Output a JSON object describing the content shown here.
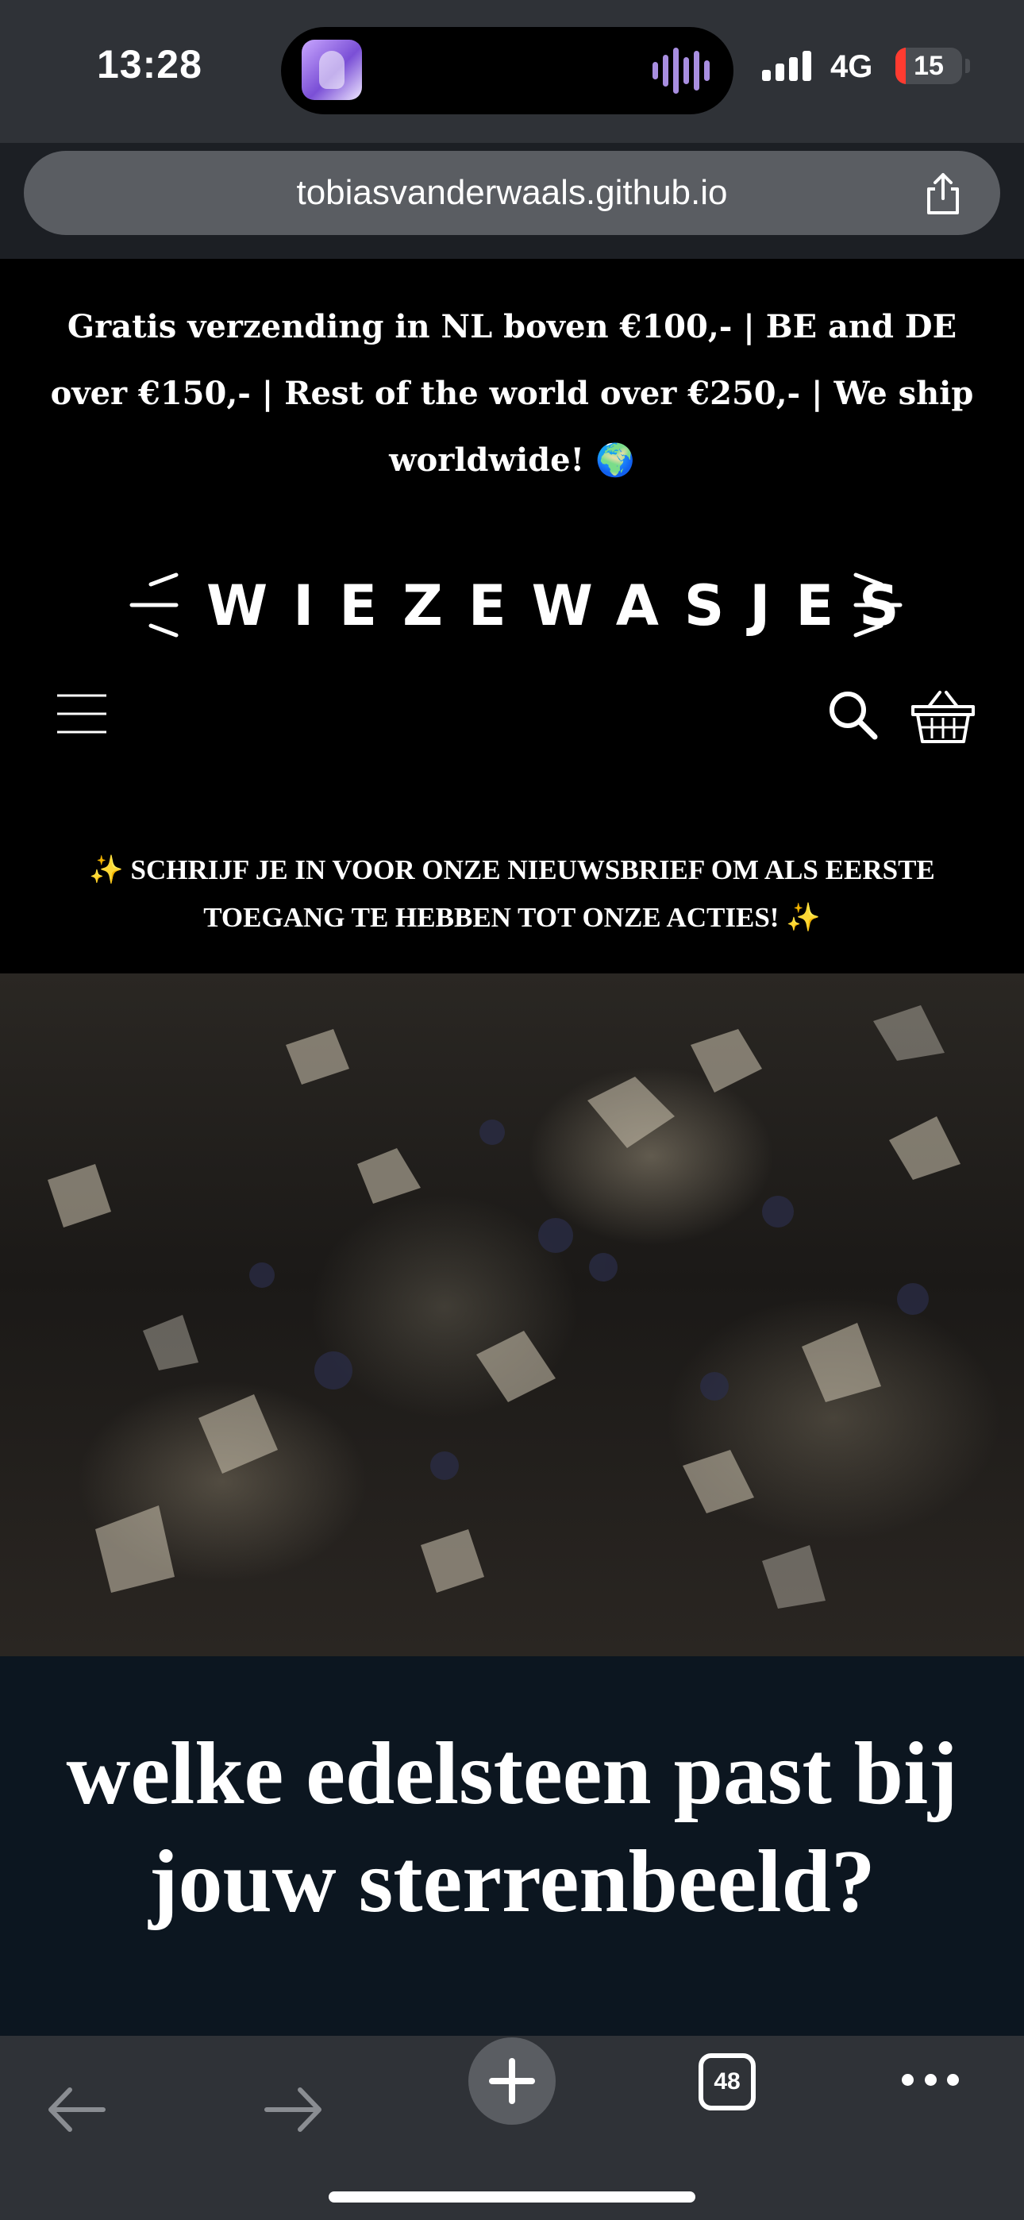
{
  "status_bar": {
    "time": "13:28",
    "network": "4G",
    "battery": "15",
    "battery_level": 0.15,
    "battery_color": "#ff3b30",
    "island_app_icon": "avatar-icon",
    "island_activity_icon": "waveform-icon"
  },
  "browser": {
    "url": "tobiasvanderwaals.github.io",
    "share_icon": "share-icon",
    "tab_count": "48",
    "toolbar_icons": [
      "back-arrow-icon",
      "forward-arrow-icon",
      "plus-icon",
      "tabs-icon",
      "more-icon"
    ]
  },
  "site": {
    "shipping_banner": "Gratis verzending in NL boven €100,- | BE and DE over €150,- | Rest of the world over €250,- | We ship worldwide! 🌍",
    "logo_text": "WIEZEWASJES",
    "header_icons": [
      "menu-icon",
      "search-icon",
      "basket-icon"
    ],
    "newsletter_banner": "✨ SCHRIJF JE IN VOOR ONZE NIEUWSBRIEF OM ALS EERSTE TOEGANG TE HEBBEN TOT ONZE ACTIES! ✨",
    "hero_title": "welke edelsteen past bij jouw sterrenbeeld?"
  }
}
